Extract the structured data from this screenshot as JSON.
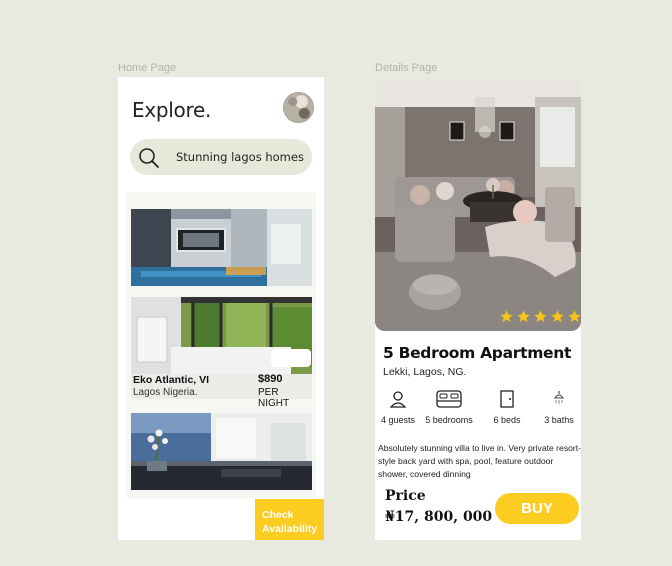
{
  "frames": {
    "home_label": "Home Page",
    "details_label": "Details Page"
  },
  "home": {
    "title": "Explore.",
    "search": {
      "value": "Stunning lagos homes",
      "icon": "search-icon"
    },
    "listing": {
      "name": "Eko Atlantic, VI",
      "location": "Lagos Nigeria.",
      "price": "$890",
      "per": "PER NIGHT"
    },
    "check_button": "Check Availability"
  },
  "details": {
    "rating_stars": 5,
    "title": "5 Bedroom Apartment",
    "location": "Lekki, Lagos, NG.",
    "amenities": [
      {
        "icon": "user-icon",
        "label": "4 guests"
      },
      {
        "icon": "bed-icon",
        "label": "5 bedrooms"
      },
      {
        "icon": "door-icon",
        "label": "6 beds"
      },
      {
        "icon": "shower-icon",
        "label": "3 baths"
      }
    ],
    "description": "Absolutely stunning villa to live in. Very private resort-style back yard with spa,  pool, feature outdoor shower, covered dinning",
    "price_label": "Price",
    "price_value": "₦17, 800, 000",
    "buy_button": "BUY"
  },
  "colors": {
    "background": "#e9eadf",
    "accent": "#fccc21",
    "search_bg": "#e6e9d9",
    "star": "#f5c518"
  }
}
